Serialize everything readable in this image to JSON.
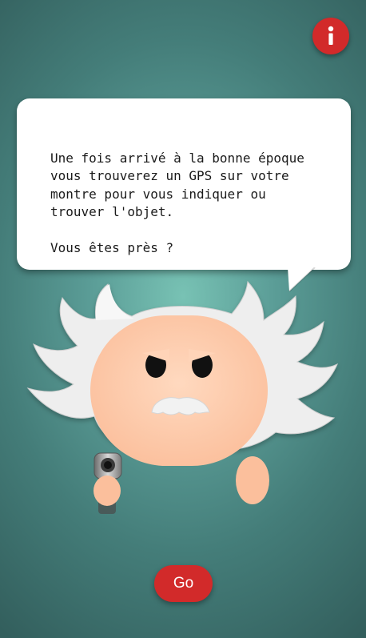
{
  "header": {
    "info_icon": "info-icon"
  },
  "dialog": {
    "message": "Une fois arrivé à la bonne époque\nvous trouverez un GPS sur votre\nmontre pour vous indiquer ou\ntrouver l'objet.\n\nVous êtes près ?"
  },
  "character": {
    "icon": "scientist-character-icon",
    "hand_item_icon": "pistol-icon"
  },
  "actions": {
    "go_label": "Go"
  },
  "colors": {
    "accent": "#d22a2a",
    "background_center": "#78c2b4",
    "background_edge": "#335f5d",
    "skin": "#ffcaa8",
    "hair": "#f0f0f0"
  }
}
